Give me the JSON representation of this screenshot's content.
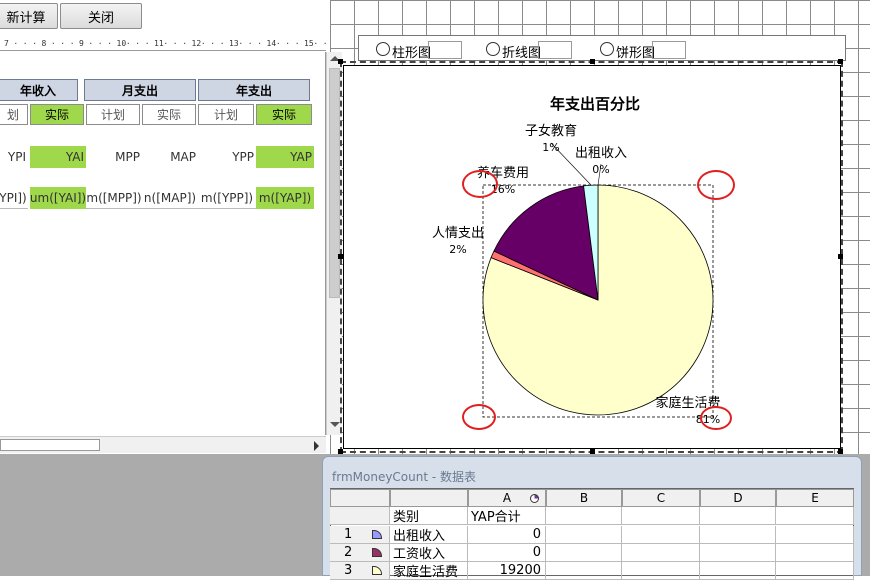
{
  "toolbar": {
    "recalc_label": "新计算",
    "close_label": "关闭"
  },
  "ruler": {
    "ticks": [
      "7",
      "8",
      "9",
      "10",
      "11",
      "12",
      "13",
      "14",
      "15"
    ]
  },
  "report": {
    "headers": [
      "年收入",
      "月支出",
      "年支出"
    ],
    "subheaders": [
      "划",
      "实际",
      "计划",
      "实际",
      "计划",
      "实际"
    ],
    "row1": [
      "YPI",
      "YAI",
      "MPP",
      "MAP",
      "YPP",
      "YAP"
    ],
    "row2": [
      "YPI])",
      "um([YAI])",
      "m([MPP])",
      "n([MAP])",
      "m([YPP])",
      "m([YAP])"
    ]
  },
  "chart_options": [
    "柱形图",
    "折线图",
    "饼形图"
  ],
  "chart_data": {
    "type": "pie",
    "title": "年支出百分比",
    "slices": [
      {
        "label": "家庭生活费",
        "percent_label": "81%",
        "value": 81,
        "color": "#ffffcc"
      },
      {
        "label": "出租收入",
        "percent_label": "0%",
        "value": 0,
        "color": "#ffffcc"
      },
      {
        "label": "子女教育",
        "percent_label": "1%",
        "value": 1,
        "color": "#ff7070"
      },
      {
        "label": "养车费用",
        "percent_label": "16%",
        "value": 16,
        "color": "#660066"
      },
      {
        "label": "人情支出",
        "percent_label": "2%",
        "value": 2,
        "color": "#ccffff"
      }
    ]
  },
  "datasheet": {
    "title": "frmMoneyCount - 数据表",
    "columns": [
      "A",
      "B",
      "C",
      "D",
      "E"
    ],
    "col_header_row": [
      "类别",
      "YAP合计"
    ],
    "rows": [
      {
        "num": "1",
        "category": "出租收入",
        "value": "0",
        "color": "#9999ff"
      },
      {
        "num": "2",
        "category": "工资收入",
        "value": "0",
        "color": "#993366"
      },
      {
        "num": "3",
        "category": "家庭生活费",
        "value": "19200",
        "color": "#ffffcc"
      }
    ]
  }
}
